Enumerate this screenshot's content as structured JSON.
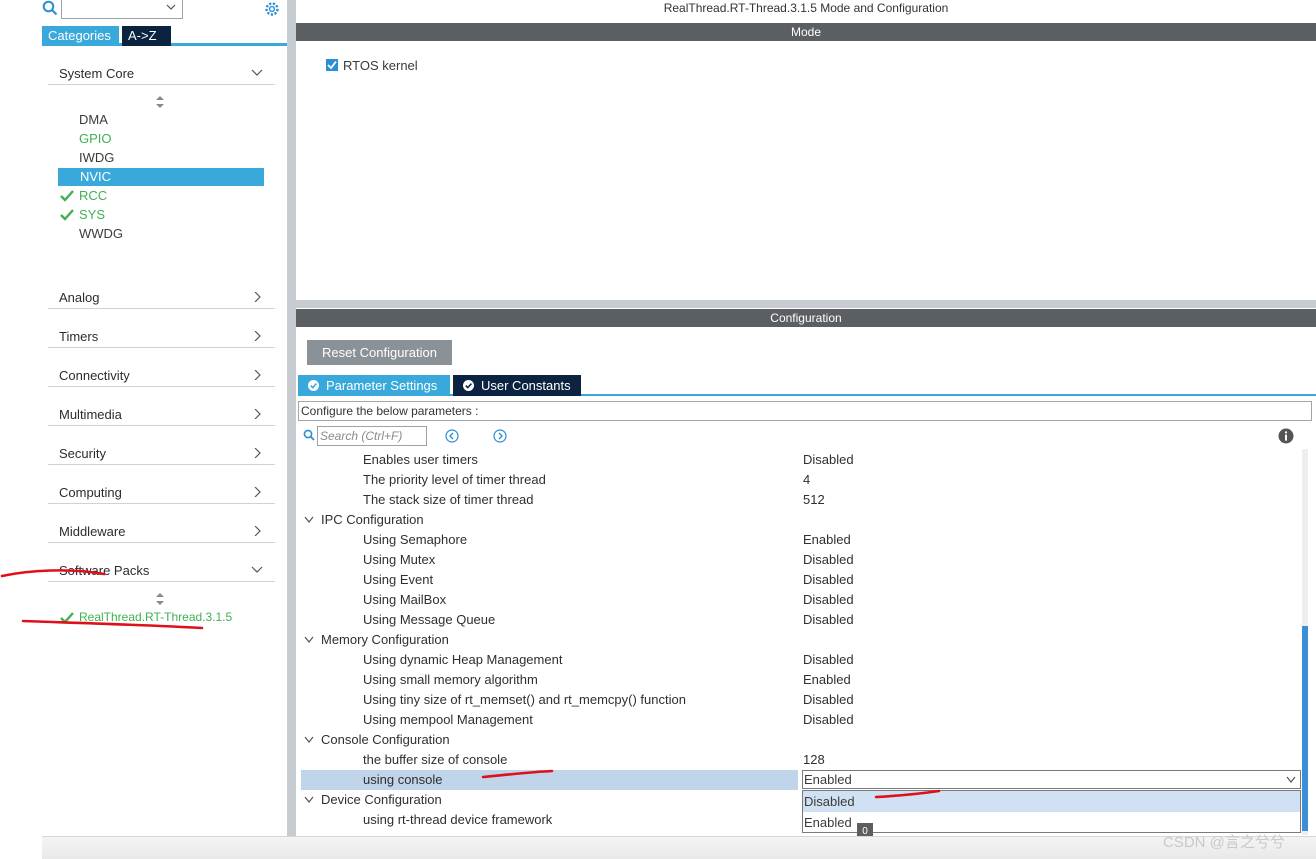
{
  "left_panel": {
    "tabs": {
      "categories": "Categories",
      "az": "A->Z"
    },
    "groups": {
      "system_core": "System Core",
      "analog": "Analog",
      "timers": "Timers",
      "connectivity": "Connectivity",
      "multimedia": "Multimedia",
      "security": "Security",
      "computing": "Computing",
      "middleware": "Middleware",
      "software_packs": "Software Packs"
    },
    "system_core_items": [
      "DMA",
      "GPIO",
      "IWDG",
      "NVIC",
      "RCC",
      "SYS",
      "WWDG"
    ],
    "software_pack_item": "RealThread.RT-Thread.3.1.5"
  },
  "right_panel": {
    "window_title": "RealThread.RT-Thread.3.1.5 Mode and Configuration",
    "mode_header": "Mode",
    "mode_checkbox_label": "RTOS kernel",
    "config_header": "Configuration",
    "reset_button": "Reset Configuration",
    "tabs": {
      "params": "Parameter Settings",
      "consts": "User Constants"
    },
    "hint": "Configure the below parameters :",
    "search_placeholder": "Search (Ctrl+F)",
    "rows": [
      {
        "name": "Enables user timers",
        "value": "Disabled"
      },
      {
        "name": "The priority level of timer thread",
        "value": "4"
      },
      {
        "name": "The stack size of timer thread",
        "value": "512"
      },
      {
        "name": "IPC Configuration",
        "value": ""
      },
      {
        "name": "Using Semaphore",
        "value": "Enabled"
      },
      {
        "name": "Using Mutex",
        "value": "Disabled"
      },
      {
        "name": "Using Event",
        "value": "Disabled"
      },
      {
        "name": "Using MailBox",
        "value": "Disabled"
      },
      {
        "name": "Using Message Queue",
        "value": "Disabled"
      },
      {
        "name": "Memory Configuration",
        "value": ""
      },
      {
        "name": "Using dynamic Heap Management",
        "value": "Disabled"
      },
      {
        "name": "Using small memory algorithm",
        "value": "Enabled"
      },
      {
        "name": "Using tiny size of rt_memset() and rt_memcpy() function",
        "value": "Disabled"
      },
      {
        "name": "Using mempool Management",
        "value": "Disabled"
      },
      {
        "name": "Console Configuration",
        "value": ""
      },
      {
        "name": "the buffer size of console",
        "value": "128"
      },
      {
        "name": "using console",
        "value": "Enabled"
      },
      {
        "name": "Device Configuration",
        "value": ""
      },
      {
        "name": "using rt-thread device framework",
        "value": ""
      }
    ],
    "dropdown_options": [
      "Disabled",
      "Enabled"
    ],
    "badge": "0"
  },
  "watermark": "CSDN @言之兮兮",
  "colors": {
    "accent": "#39a9dc",
    "navy": "#0b2340",
    "green": "#3fb152",
    "annotation": "#e0101a"
  }
}
